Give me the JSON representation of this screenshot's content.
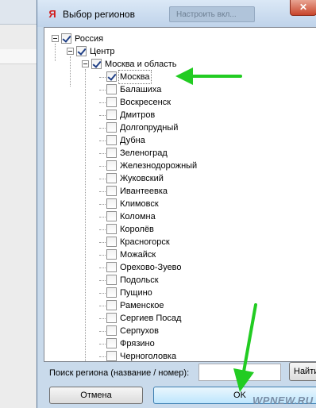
{
  "dialog": {
    "app_icon": "yandex-y-icon",
    "app_icon_glyph": "Я",
    "title": "Выбор регионов",
    "background_tab": "Настроить вкл...",
    "close_glyph": "✕"
  },
  "tree": {
    "root": {
      "label": "Россия",
      "checked": true,
      "expanded": true
    },
    "region": {
      "label": "Центр",
      "checked": true,
      "expanded": true
    },
    "area": {
      "label": "Москва и область",
      "checked": true,
      "expanded": true
    },
    "cities": [
      {
        "label": "Москва",
        "checked": true
      },
      {
        "label": "Балашиха",
        "checked": false
      },
      {
        "label": "Воскресенск",
        "checked": false
      },
      {
        "label": "Дмитров",
        "checked": false
      },
      {
        "label": "Долгопрудный",
        "checked": false
      },
      {
        "label": "Дубна",
        "checked": false
      },
      {
        "label": "Зеленоград",
        "checked": false
      },
      {
        "label": "Железнодорожный",
        "checked": false
      },
      {
        "label": "Жуковский",
        "checked": false
      },
      {
        "label": "Ивантеевка",
        "checked": false
      },
      {
        "label": "Климовск",
        "checked": false
      },
      {
        "label": "Коломна",
        "checked": false
      },
      {
        "label": "Королёв",
        "checked": false
      },
      {
        "label": "Красногорск",
        "checked": false
      },
      {
        "label": "Можайск",
        "checked": false
      },
      {
        "label": "Орехово-Зуево",
        "checked": false
      },
      {
        "label": "Подольск",
        "checked": false
      },
      {
        "label": "Пущино",
        "checked": false
      },
      {
        "label": "Раменское",
        "checked": false
      },
      {
        "label": "Сергиев Посад",
        "checked": false
      },
      {
        "label": "Серпухов",
        "checked": false
      },
      {
        "label": "Фрязино",
        "checked": false
      },
      {
        "label": "Черноголовка",
        "checked": false
      }
    ]
  },
  "search": {
    "label": "Поиск региона (название / номер):",
    "value": "",
    "find_label": "Найти"
  },
  "buttons": {
    "cancel": "Отмена",
    "ok": "OK"
  },
  "watermark": "WPNEW.RU",
  "colors": {
    "arrow": "#22cc22",
    "frame": "#c9daeb",
    "close": "#c8452c"
  }
}
